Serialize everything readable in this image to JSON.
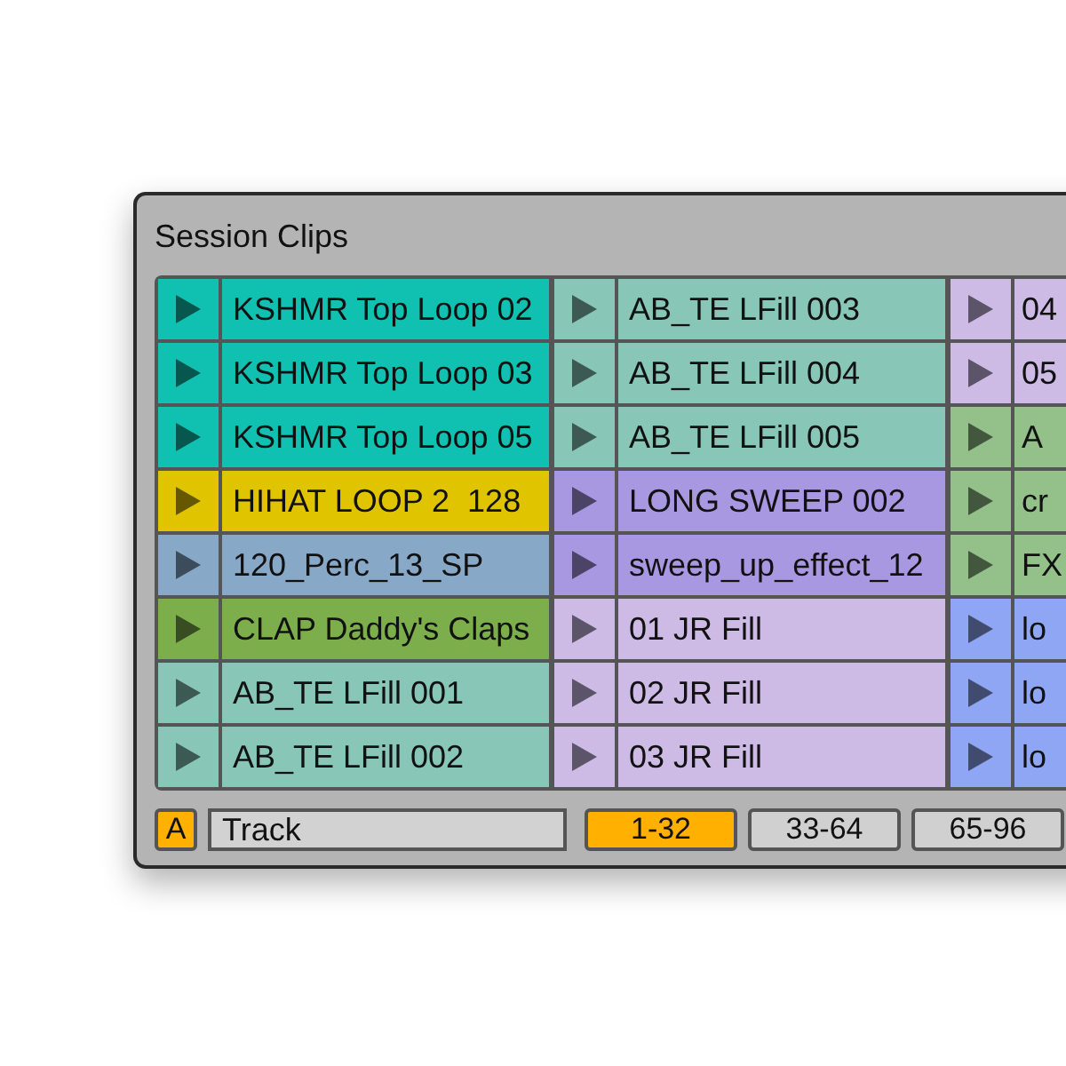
{
  "window": {
    "title": "Session Clips"
  },
  "columns": [
    {
      "clips": [
        {
          "name": "KSHMR Top Loop 02",
          "color": "#10c0b0"
        },
        {
          "name": "KSHMR Top Loop 03",
          "color": "#10c0b0"
        },
        {
          "name": "KSHMR Top Loop 05",
          "color": "#10c0b0"
        },
        {
          "name": "HIHAT LOOP 2  128",
          "color": "#e0c400"
        },
        {
          "name": "120_Perc_13_SP",
          "color": "#88a8c8"
        },
        {
          "name": "CLAP Daddy's Claps",
          "color": "#7cae4c"
        },
        {
          "name": "AB_TE LFill 001",
          "color": "#88c6b8"
        },
        {
          "name": "AB_TE LFill 002",
          "color": "#88c6b8"
        }
      ]
    },
    {
      "clips": [
        {
          "name": "AB_TE LFill 003",
          "color": "#88c6b8"
        },
        {
          "name": "AB_TE LFill 004",
          "color": "#88c6b8"
        },
        {
          "name": "AB_TE LFill 005",
          "color": "#88c6b8"
        },
        {
          "name": "LONG SWEEP 002",
          "color": "#a898e2"
        },
        {
          "name": "sweep_up_effect_12",
          "color": "#a898e2"
        },
        {
          "name": "01 JR Fill",
          "color": "#cdbbe6"
        },
        {
          "name": "02 JR Fill",
          "color": "#cdbbe6"
        },
        {
          "name": "03 JR Fill",
          "color": "#cdbbe6"
        }
      ]
    },
    {
      "clips": [
        {
          "name": "04",
          "color": "#cdbbe6"
        },
        {
          "name": "05",
          "color": "#cdbbe6"
        },
        {
          "name": "A",
          "color": "#94c08a"
        },
        {
          "name": "cr",
          "color": "#94c08a"
        },
        {
          "name": "FX",
          "color": "#94c08a"
        },
        {
          "name": "lo",
          "color": "#8ea6f4"
        },
        {
          "name": "lo",
          "color": "#8ea6f4"
        },
        {
          "name": "lo",
          "color": "#8ea6f4"
        }
      ]
    }
  ],
  "footer": {
    "toggle": {
      "label": "A",
      "on": true
    },
    "search": {
      "value": "Track"
    },
    "pages": [
      {
        "label": "1-32",
        "selected": true
      },
      {
        "label": "33-64",
        "selected": false
      },
      {
        "label": "65-96",
        "selected": false
      }
    ]
  }
}
